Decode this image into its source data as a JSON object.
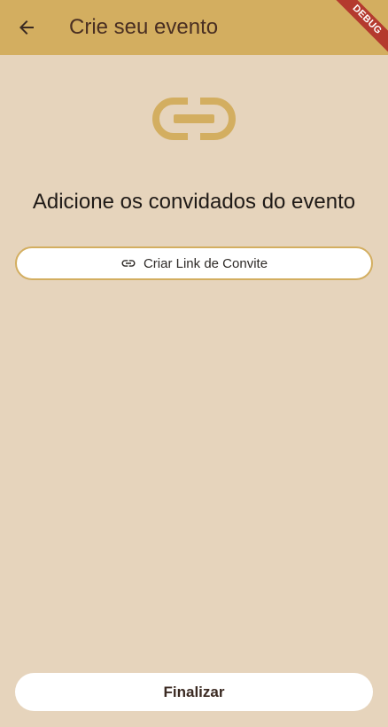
{
  "appbar": {
    "title": "Crie seu evento",
    "back_icon": "arrow-left-icon",
    "debug_label": "DEBUG"
  },
  "hero": {
    "icon": "link-icon",
    "heading": "Adicione os convidados do evento"
  },
  "invite_button": {
    "icon": "link-icon",
    "label": "Criar Link de Convite"
  },
  "finish_button": {
    "label": "Finalizar"
  },
  "colors": {
    "background": "#e6d4bc",
    "appbar": "#d3ae60",
    "accent": "#d3ae60",
    "debug_banner": "#b43a2e",
    "button_bg": "#ffffff"
  }
}
